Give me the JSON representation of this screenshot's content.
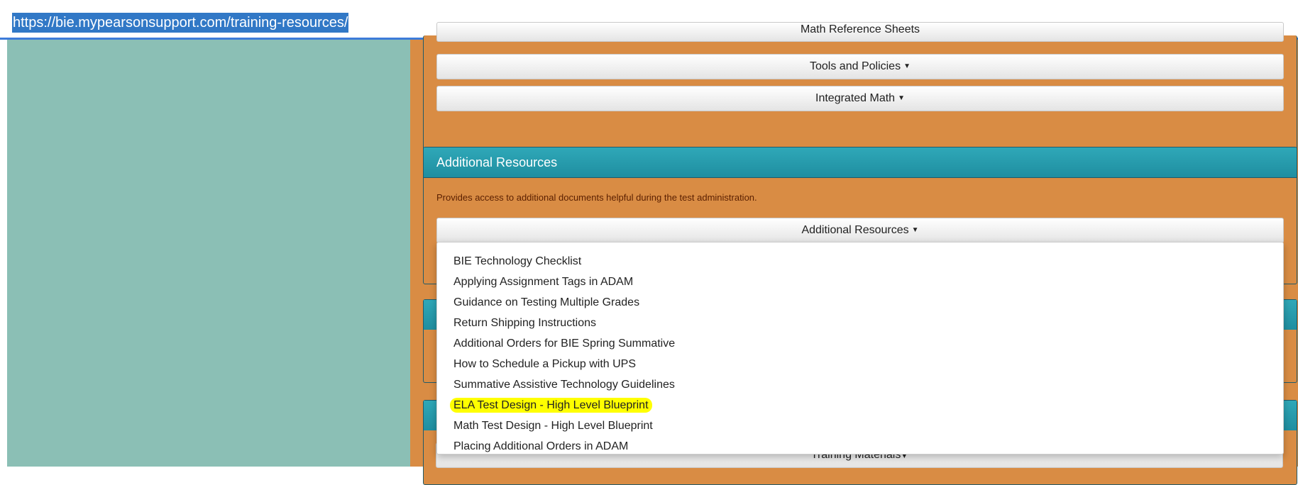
{
  "url": "https://bie.mypearsonsupport.com/training-resources/",
  "top_section": {
    "math_ref_label": "Math Reference Sheets",
    "tools_label": "Tools and Policies",
    "integrated_math_label": "Integrated Math"
  },
  "additional_resources": {
    "title": "Additional Resources",
    "description": "Provides access to additional documents helpful during the test administration.",
    "button_label": "Additional Resources",
    "menu_items": [
      "BIE Technology Checklist",
      "Applying Assignment Tags in ADAM",
      "Guidance on Testing Multiple Grades",
      "Return Shipping Instructions",
      "Additional Orders for BIE Spring Summative",
      "How to Schedule a Pickup with UPS",
      "Summative Assistive Technology Guidelines",
      "ELA Test Design - High Level Blueprint",
      "Math Test Design - High Level Blueprint",
      "Placing Additional Orders in ADAM"
    ],
    "highlighted_item": "ELA Test Design - High Level Blueprint"
  },
  "training_materials_label": "Training Materials",
  "colors": {
    "teal_bg": "#8bbfb5",
    "orange_bg": "#d98c44",
    "panel_header": "#2fa8b8",
    "highlight": "#ffff00",
    "url_selection": "#3178c6"
  }
}
